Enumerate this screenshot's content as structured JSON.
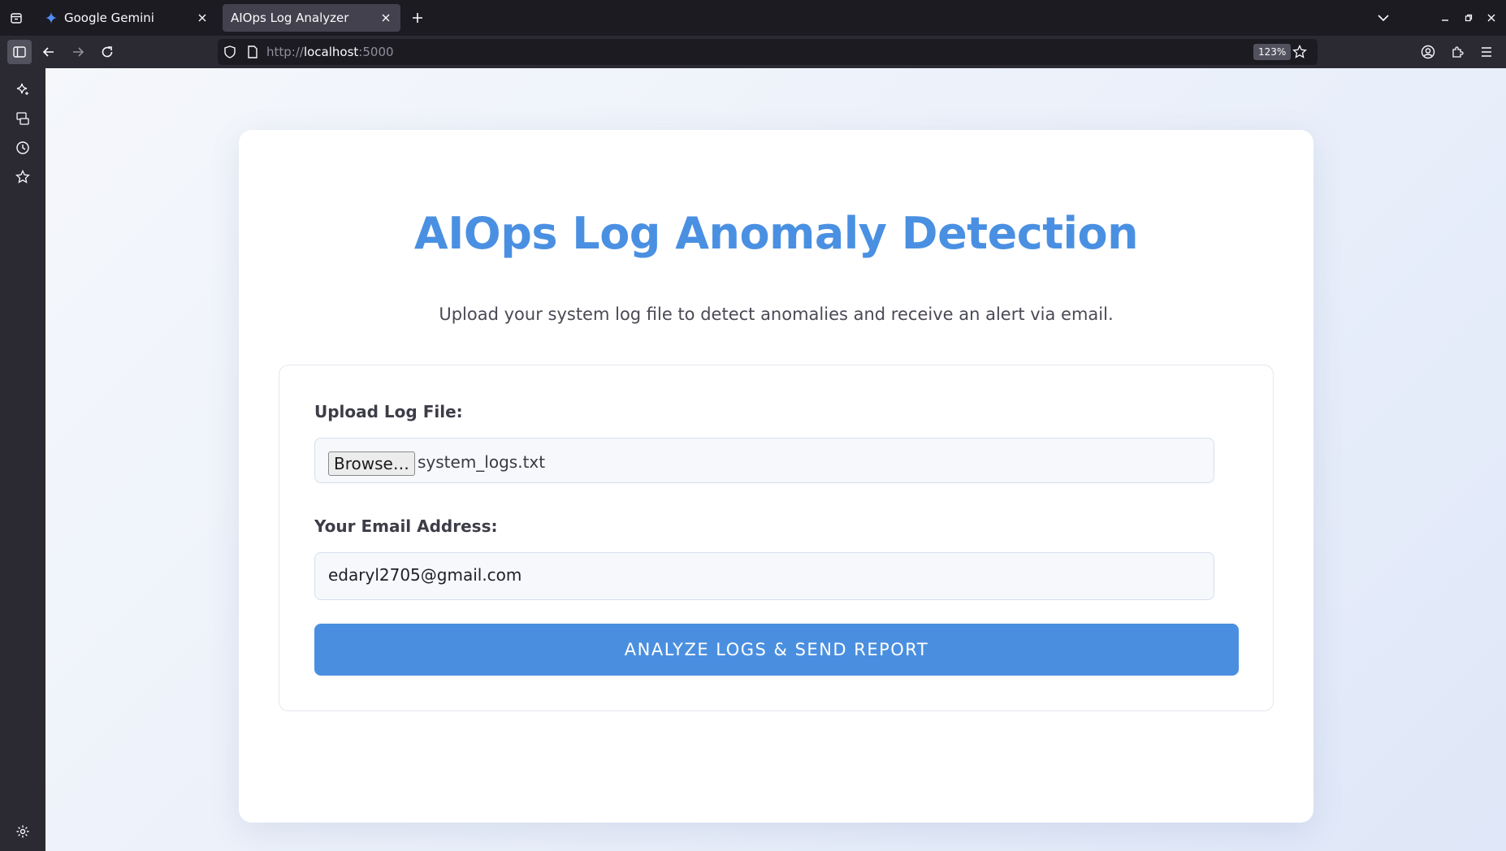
{
  "browser": {
    "tabs": [
      {
        "title": "Google Gemini",
        "active": false,
        "favicon": "gemini-sparkle-icon"
      },
      {
        "title": "AIOps Log Analyzer",
        "active": true,
        "favicon": "none"
      }
    ],
    "url_scheme": "http://",
    "url_host": "localhost",
    "url_port": ":5000",
    "zoom": "123%",
    "colors": {
      "tabbar_bg": "#1c1b22",
      "toolbar_bg": "#2b2a33",
      "active_tab_bg": "#42414d"
    }
  },
  "page": {
    "title": "AIOps Log Anomaly Detection",
    "subtitle": "Upload your system log file to detect anomalies and receive an alert via email.",
    "form": {
      "upload_label": "Upload Log File:",
      "browse_label": "Browse…",
      "file_name": "system_logs.txt",
      "email_label": "Your Email Address:",
      "email_value": "edaryl2705@gmail.com",
      "submit_label": "ANALYZE LOGS & SEND REPORT"
    },
    "colors": {
      "accent": "#4a90e2",
      "button": "#4a8fdf"
    }
  }
}
